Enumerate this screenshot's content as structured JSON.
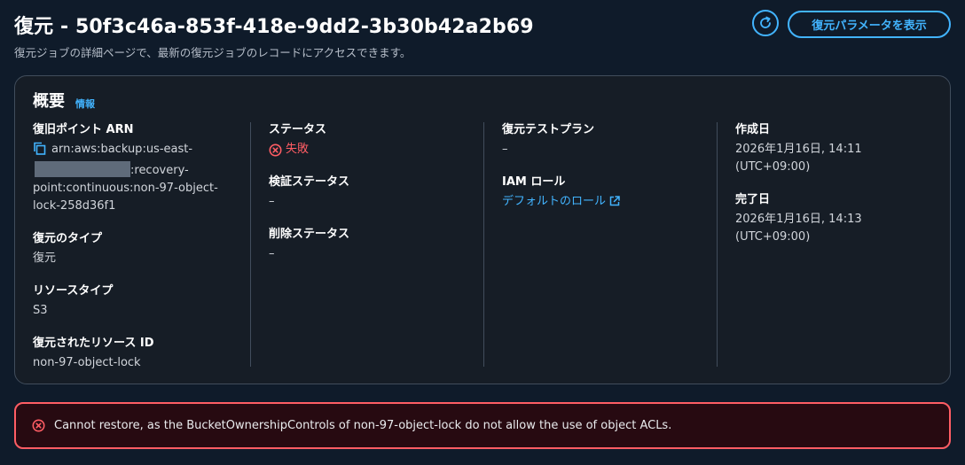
{
  "header": {
    "title": "復元 - 50f3c46a-853f-418e-9dd2-3b30b42a2b69",
    "subtitle": "復元ジョブの詳細ページで、最新の復元ジョブのレコードにアクセスできます。",
    "view_params_label": "復元パラメータを表示",
    "refresh_icon": "refresh-icon"
  },
  "overview": {
    "title": "概要",
    "info_label": "情報",
    "recovery_point": {
      "label": "復旧ポイント ARN",
      "line1": "arn:aws:backup:us-east-",
      "line2_suffix": ":recovery-",
      "line3": "point:continuous:non-97-object-",
      "line4": "lock-258d36f1"
    },
    "restore_type": {
      "label": "復元のタイプ",
      "value": "復元"
    },
    "resource_type": {
      "label": "リソースタイプ",
      "value": "S3"
    },
    "restored_resource_id": {
      "label": "復元されたリソース ID",
      "value": "non-97-object-lock"
    },
    "status": {
      "label": "ステータス",
      "value": "失敗"
    },
    "validation_status": {
      "label": "検証ステータス",
      "value": "–"
    },
    "deletion_status": {
      "label": "削除ステータス",
      "value": "–"
    },
    "test_plan": {
      "label": "復元テストプラン",
      "value": "–"
    },
    "iam_role": {
      "label": "IAM ロール",
      "value": "デフォルトのロール"
    },
    "created": {
      "label": "作成日",
      "date": "2026年1月16日, 14:11",
      "tz": "(UTC+09:00)"
    },
    "completed": {
      "label": "完了日",
      "date": "2026年1月16日, 14:13",
      "tz": "(UTC+09:00)"
    }
  },
  "alert": {
    "message": "Cannot restore, as the BucketOwnershipControls of non-97-object-lock do not allow the use of object ACLs."
  },
  "colors": {
    "background": "#0f1b2a",
    "panel": "#161d26",
    "accent": "#42b4ff",
    "error": "#ff5d64",
    "alert_bg": "#270a11"
  }
}
